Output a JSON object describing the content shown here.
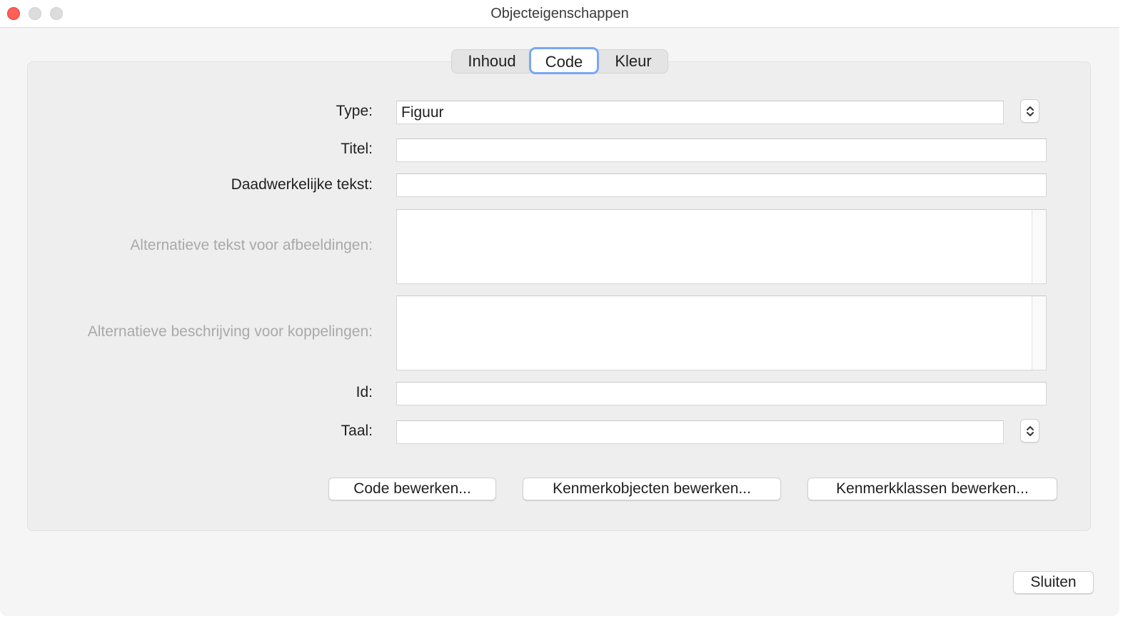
{
  "window": {
    "title": "Objecteigenschappen"
  },
  "tabs": [
    {
      "label": "Inhoud",
      "selected": false
    },
    {
      "label": "Code",
      "selected": true
    },
    {
      "label": "Kleur",
      "selected": false
    }
  ],
  "form": {
    "type_label": "Type:",
    "type_value": "Figuur",
    "title_label": "Titel:",
    "title_value": "",
    "actual_text_label": "Daadwerkelijke tekst:",
    "actual_text_value": "",
    "alt_text_label": "Alternatieve tekst voor afbeeldingen:",
    "alt_text_value": "",
    "alt_desc_label": "Alternatieve beschrijving voor koppelingen:",
    "alt_desc_value": "",
    "id_label": "Id:",
    "id_value": "",
    "lang_label": "Taal:",
    "lang_value": ""
  },
  "actions": {
    "edit_code": "Code bewerken...",
    "edit_attr_objects": "Kenmerkobjecten bewerken...",
    "edit_attr_classes": "Kenmerkklassen bewerken..."
  },
  "footer": {
    "close_label": "Sluiten"
  },
  "icons": {
    "stepper": "up-down-chevron-icon"
  },
  "colors": {
    "accent_focus": "#7aa7f5",
    "close_red": "#fe5f57"
  }
}
